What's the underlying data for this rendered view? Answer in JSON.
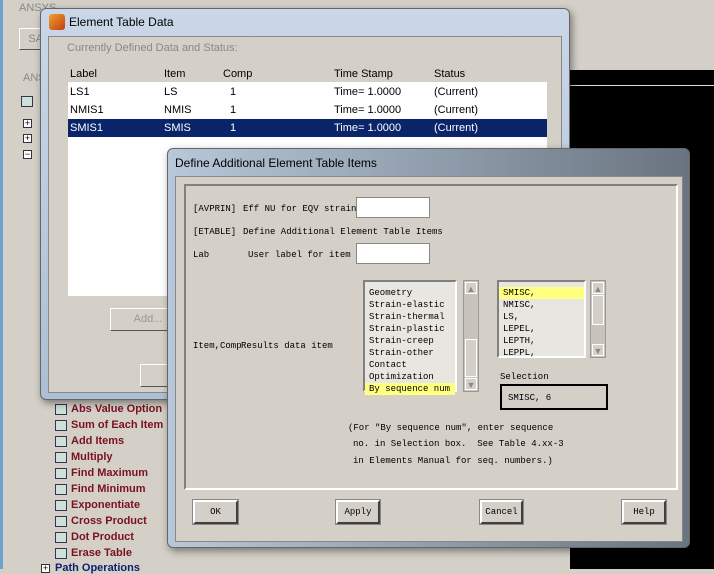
{
  "background": {
    "title_fragment": "ANSYS",
    "toolbar_fragment": "SAV",
    "menu_fragment": "ANS"
  },
  "tree": {
    "items": [
      "Abs Value Option",
      "Sum of Each Item",
      "Add Items",
      "Multiply",
      "Find Maximum",
      "Find Minimum",
      "Exponentiate",
      "Cross Product",
      "Dot Product",
      "Erase Table"
    ],
    "path_operations": "Path Operations"
  },
  "etable": {
    "title": "Element Table Data",
    "status_heading": "Currently Defined Data and Status:",
    "columns": [
      "Label",
      "Item",
      "Comp",
      "Time Stamp",
      "Status"
    ],
    "rows": [
      {
        "label": "LS1",
        "item": "LS",
        "comp": "1",
        "time": "Time=  1.0000",
        "status": "(Current)"
      },
      {
        "label": "NMIS1",
        "item": "NMIS",
        "comp": "1",
        "time": "Time=  1.0000",
        "status": "(Current)"
      },
      {
        "label": "SMIS1",
        "item": "SMIS",
        "comp": "1",
        "time": "Time=  1.0000",
        "status": "(Current)"
      }
    ],
    "selected_row": 2,
    "add_button": "Add..."
  },
  "define": {
    "title": "Define Additional Element Table Items",
    "avprin_tag": "[AVPRIN]",
    "avprin_label": "Eff NU for EQV strain",
    "avprin_value": "",
    "etable_tag": "[ETABLE]",
    "etable_label": "Define Additional Element Table Items",
    "lab_tag": "Lab",
    "lab_label": "User label for item",
    "lab_value": "",
    "item_tag": "Item,Comp",
    "item_label": "Results data item",
    "categories": [
      "Geometry",
      "Strain-elastic",
      "Strain-thermal",
      "Strain-plastic",
      "Strain-creep",
      "Strain-other",
      "Contact",
      "Optimization",
      "By sequence num"
    ],
    "selected_category": "By sequence num",
    "components": [
      "SMISC,",
      "NMISC,",
      "LS,",
      "LEPEL,",
      "LEPTH,",
      "LEPPL,"
    ],
    "selected_component": "SMISC,",
    "selection_label": "Selection",
    "selection_value": "SMISC, 6",
    "note": [
      "(For \"By sequence num\", enter sequence",
      "no. in Selection box.  See Table 4.xx-3",
      "in Elements Manual for seq. numbers.)"
    ],
    "buttons": {
      "ok": "OK",
      "apply": "Apply",
      "cancel": "Cancel",
      "help": "Help"
    }
  },
  "colors": {
    "selection": "#0a246a",
    "highlight": "#ffff80",
    "tree_text": "#7a1020"
  }
}
